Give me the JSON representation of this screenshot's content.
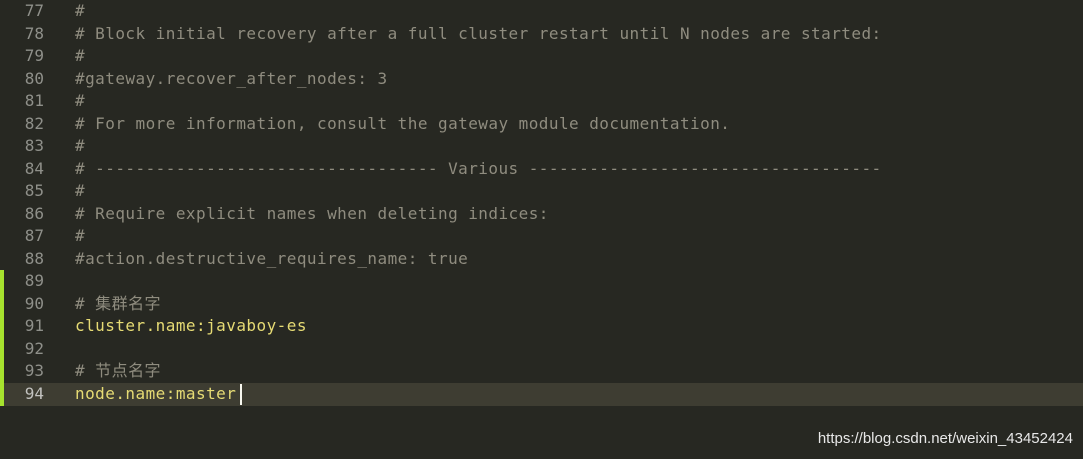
{
  "editor": {
    "lines": [
      {
        "number": "77",
        "text": "#"
      },
      {
        "number": "78",
        "text": "# Block initial recovery after a full cluster restart until N nodes are started:"
      },
      {
        "number": "79",
        "text": "#"
      },
      {
        "number": "80",
        "text": "#gateway.recover_after_nodes: 3"
      },
      {
        "number": "81",
        "text": "#"
      },
      {
        "number": "82",
        "text": "# For more information, consult the gateway module documentation."
      },
      {
        "number": "83",
        "text": "#"
      },
      {
        "number": "84",
        "text": "# ---------------------------------- Various -----------------------------------"
      },
      {
        "number": "85",
        "text": "#"
      },
      {
        "number": "86",
        "text": "# Require explicit names when deleting indices:"
      },
      {
        "number": "87",
        "text": "#"
      },
      {
        "number": "88",
        "text": "#action.destructive_requires_name: true"
      },
      {
        "number": "89",
        "text": ""
      },
      {
        "number": "90",
        "text": "# 集群名字"
      },
      {
        "number": "91",
        "text": "cluster.name:javaboy-es"
      },
      {
        "number": "92",
        "text": ""
      },
      {
        "number": "93",
        "text": "# 节点名字"
      },
      {
        "number": "94",
        "text": "node.name:master"
      }
    ],
    "modified_marker_color": "#a6e22e",
    "background_color": "#272822"
  },
  "watermark": {
    "text": "https://blog.csdn.net/weixin_43452424"
  }
}
